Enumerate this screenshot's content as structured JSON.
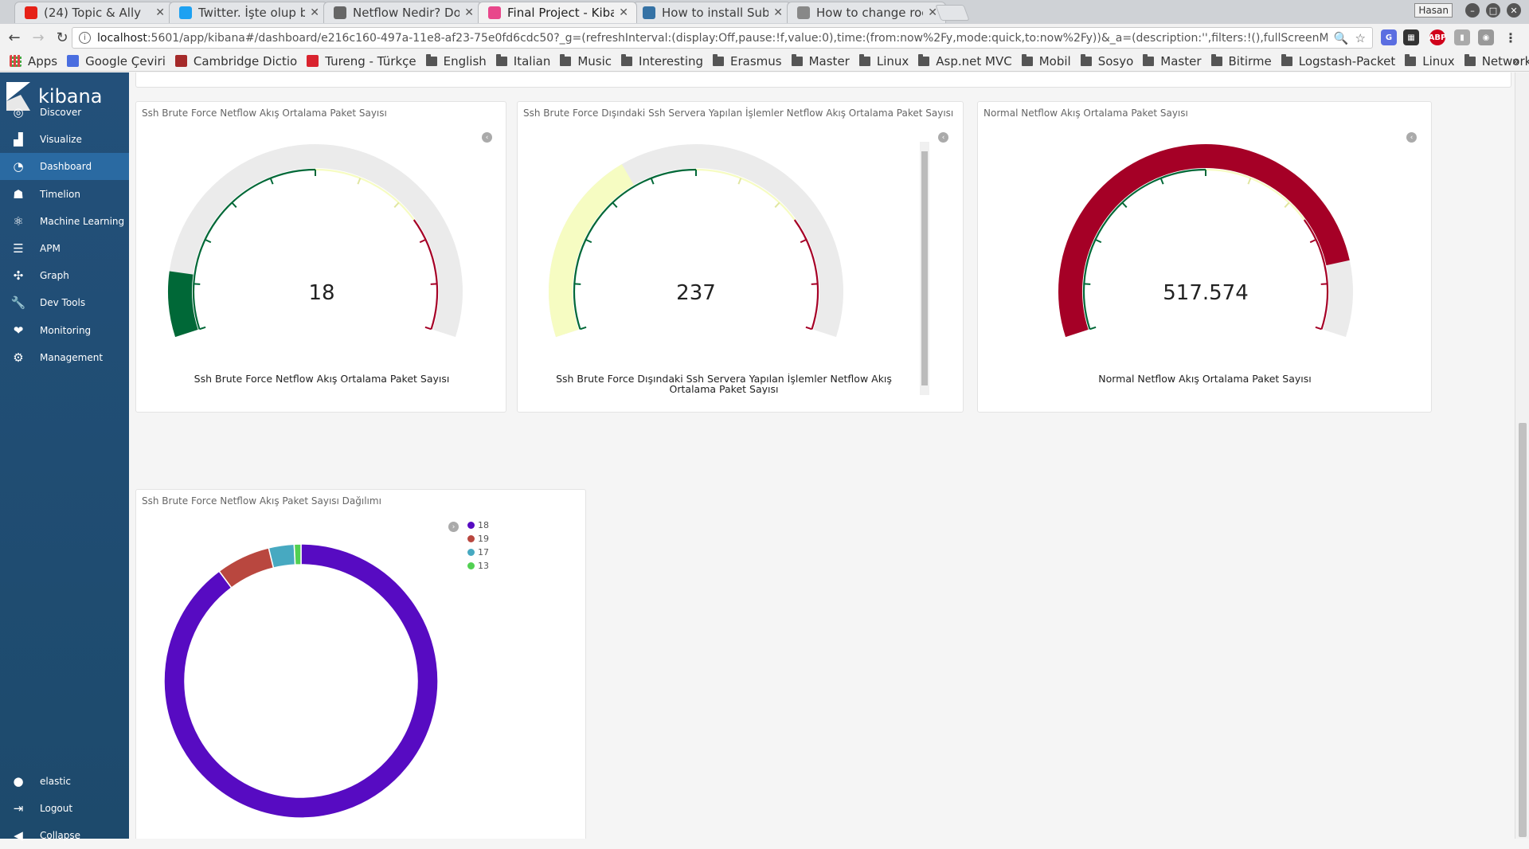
{
  "browser": {
    "tabs": [
      {
        "title": "(24) Topic & Ally",
        "color": "#e62117",
        "active": false
      },
      {
        "title": "Twitter. İşte olup bit",
        "color": "#1da1f2",
        "active": false
      },
      {
        "title": "Netflow Nedir? Doc",
        "color": "#666666",
        "active": false
      },
      {
        "title": "Final Project - Kibana",
        "color": "#e8478b",
        "active": true
      },
      {
        "title": "How to install Sublim",
        "color": "#3572a5",
        "active": false
      },
      {
        "title": "How to change root",
        "color": "#888888",
        "active": false
      }
    ],
    "profile": "Hasan",
    "url_host": "localhost",
    "url_rest": ":5601/app/kibana#/dashboard/e216c160-497a-11e8-af23-75e0fd6cdc50?_g=(refreshInterval:(display:Off,pause:!f,value:0),time:(from:now%2Fy,mode:quick,to:now%2Fy))&_a=(description:'',filters:!(),fullScreenMode:!f,options:(darkTheme:...",
    "bookmarks": [
      {
        "label": "Apps",
        "type": "apps"
      },
      {
        "label": "Google Çeviri",
        "type": "site",
        "color": "#4a6ee0"
      },
      {
        "label": "Cambridge Dictio",
        "type": "site",
        "color": "#a52a2a"
      },
      {
        "label": "Tureng - Türkçe",
        "type": "site",
        "color": "#d9232e"
      },
      {
        "label": "English",
        "type": "folder"
      },
      {
        "label": "Italian",
        "type": "folder"
      },
      {
        "label": "Music",
        "type": "folder"
      },
      {
        "label": "Interesting",
        "type": "folder"
      },
      {
        "label": "Erasmus",
        "type": "folder"
      },
      {
        "label": "Master",
        "type": "folder"
      },
      {
        "label": "Linux",
        "type": "folder"
      },
      {
        "label": "Asp.net MVC",
        "type": "folder"
      },
      {
        "label": "Mobil",
        "type": "folder"
      },
      {
        "label": "Sosyo",
        "type": "folder"
      },
      {
        "label": "Master",
        "type": "folder"
      },
      {
        "label": "Bitirme",
        "type": "folder"
      },
      {
        "label": "Logstash-Packet",
        "type": "folder"
      },
      {
        "label": "Linux",
        "type": "folder"
      },
      {
        "label": "Network",
        "type": "folder"
      }
    ],
    "bookmarks_more": "»"
  },
  "sidebar": {
    "brand": "kibana",
    "items": [
      {
        "label": "Discover",
        "icon": "compass-icon",
        "glyph": "◎"
      },
      {
        "label": "Visualize",
        "icon": "bar-chart-icon",
        "glyph": "▟"
      },
      {
        "label": "Dashboard",
        "icon": "dashboard-icon",
        "glyph": "◔",
        "active": true
      },
      {
        "label": "Timelion",
        "icon": "timelion-icon",
        "glyph": "☗"
      },
      {
        "label": "Machine Learning",
        "icon": "machine-learning-icon",
        "glyph": "⚛"
      },
      {
        "label": "APM",
        "icon": "apm-icon",
        "glyph": "☰"
      },
      {
        "label": "Graph",
        "icon": "graph-icon",
        "glyph": "✣"
      },
      {
        "label": "Dev Tools",
        "icon": "wrench-icon",
        "glyph": "🔧"
      },
      {
        "label": "Monitoring",
        "icon": "heartbeat-icon",
        "glyph": "❤"
      },
      {
        "label": "Management",
        "icon": "gear-icon",
        "glyph": "⚙"
      }
    ],
    "bottom": [
      {
        "label": "elastic",
        "icon": "user-icon",
        "glyph": "●"
      },
      {
        "label": "Logout",
        "icon": "logout-icon",
        "glyph": "⇥"
      },
      {
        "label": "Collapse",
        "icon": "collapse-icon",
        "glyph": "◀"
      }
    ]
  },
  "panels": {
    "gauge1": {
      "title": "Ssh Brute Force Netflow Akış Ortalama Paket Sayısı",
      "value": "18",
      "label": "Ssh Brute Force Netflow Akış Ortalama Paket Sayısı",
      "fill_fraction": 0.12,
      "fill_color": "#006837"
    },
    "gauge2": {
      "title": "Ssh Brute Force Dışındaki Ssh Servera Yapılan İşlemler Netflow Akış Ortalama Paket Sayısı",
      "value": "237",
      "label": "Ssh Brute Force Dışındaki Ssh Servera Yapılan İşlemler Netflow Akış Ortalama Paket Sayısı",
      "fill_fraction": 0.36,
      "fill_color": "#f6fcc2"
    },
    "gauge3": {
      "title": "Normal Netflow Akış Ortalama Paket Sayısı",
      "value": "517.574",
      "label": "Normal Netflow Akış Ortalama Paket Sayısı",
      "fill_fraction": 0.86,
      "fill_color": "#a50026"
    },
    "pie": {
      "title": "Ssh Brute Force Netflow Akış Paket Sayısı Dağılımı"
    }
  },
  "chart_data": {
    "type": "pie",
    "title": "Ssh Brute Force Netflow Akış Paket Sayısı Dağılımı",
    "categories": [
      "18",
      "19",
      "17",
      "13"
    ],
    "values": [
      89.8,
      6.4,
      3.0,
      0.8
    ],
    "colors": [
      "#570bc2",
      "#b9473f",
      "#47a9c1",
      "#52d052"
    ],
    "donut": true,
    "legend_position": "top-right"
  }
}
